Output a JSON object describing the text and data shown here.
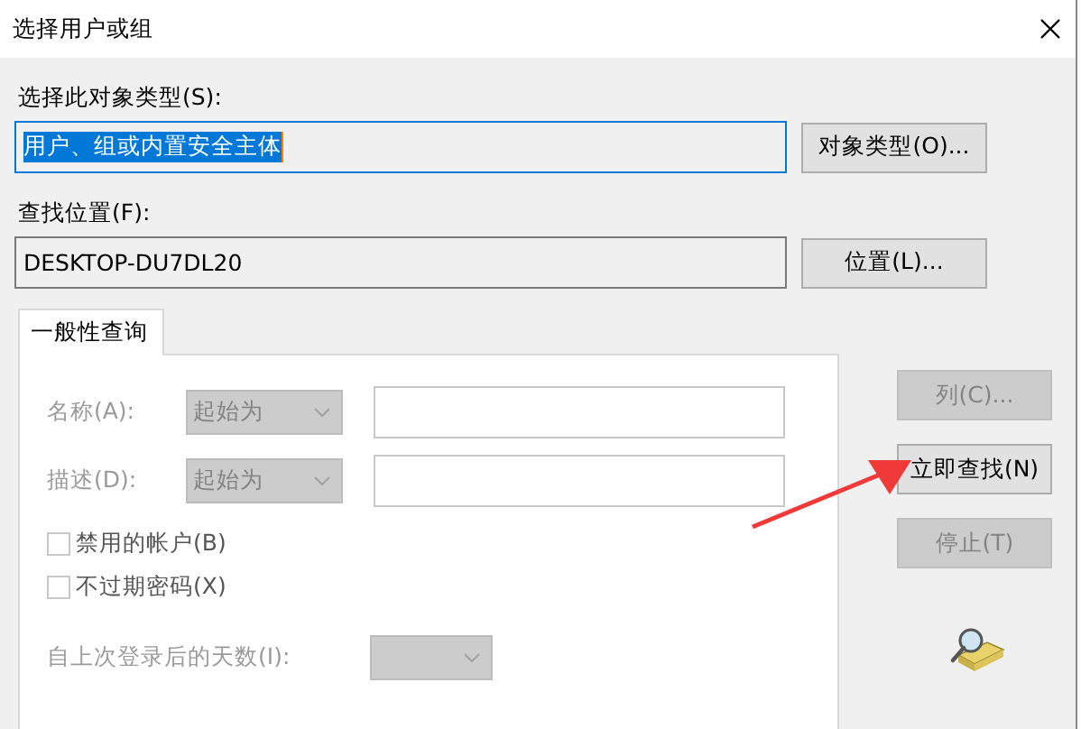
{
  "window": {
    "title": "选择用户或组"
  },
  "object_type": {
    "label": "选择此对象类型(S):",
    "value": "用户、组或内置安全主体",
    "selected": true,
    "button": "对象类型(O)..."
  },
  "location": {
    "label": "查找位置(F):",
    "value": "DESKTOP-DU7DL20",
    "selected": false,
    "button": "位置(L)..."
  },
  "tabs": [
    {
      "label": "一般性查询",
      "selected": true
    }
  ],
  "query": {
    "rows": [
      {
        "label": "名称(A):",
        "combo": "起始为",
        "disabled": true
      },
      {
        "label": "描述(D):",
        "combo": "起始为",
        "disabled": true
      }
    ],
    "checkboxes": [
      {
        "label": "禁用的帐户(B)",
        "checked": false
      },
      {
        "label": "不过期密码(X)",
        "checked": false
      }
    ],
    "days": {
      "label": "自上次登录后的天数(I):",
      "disabled": true
    }
  },
  "actions": [
    {
      "label": "列(C)...",
      "disabled": true
    },
    {
      "label": "立即查找(N)",
      "disabled": false
    },
    {
      "label": "停止(T)",
      "disabled": true
    }
  ]
}
